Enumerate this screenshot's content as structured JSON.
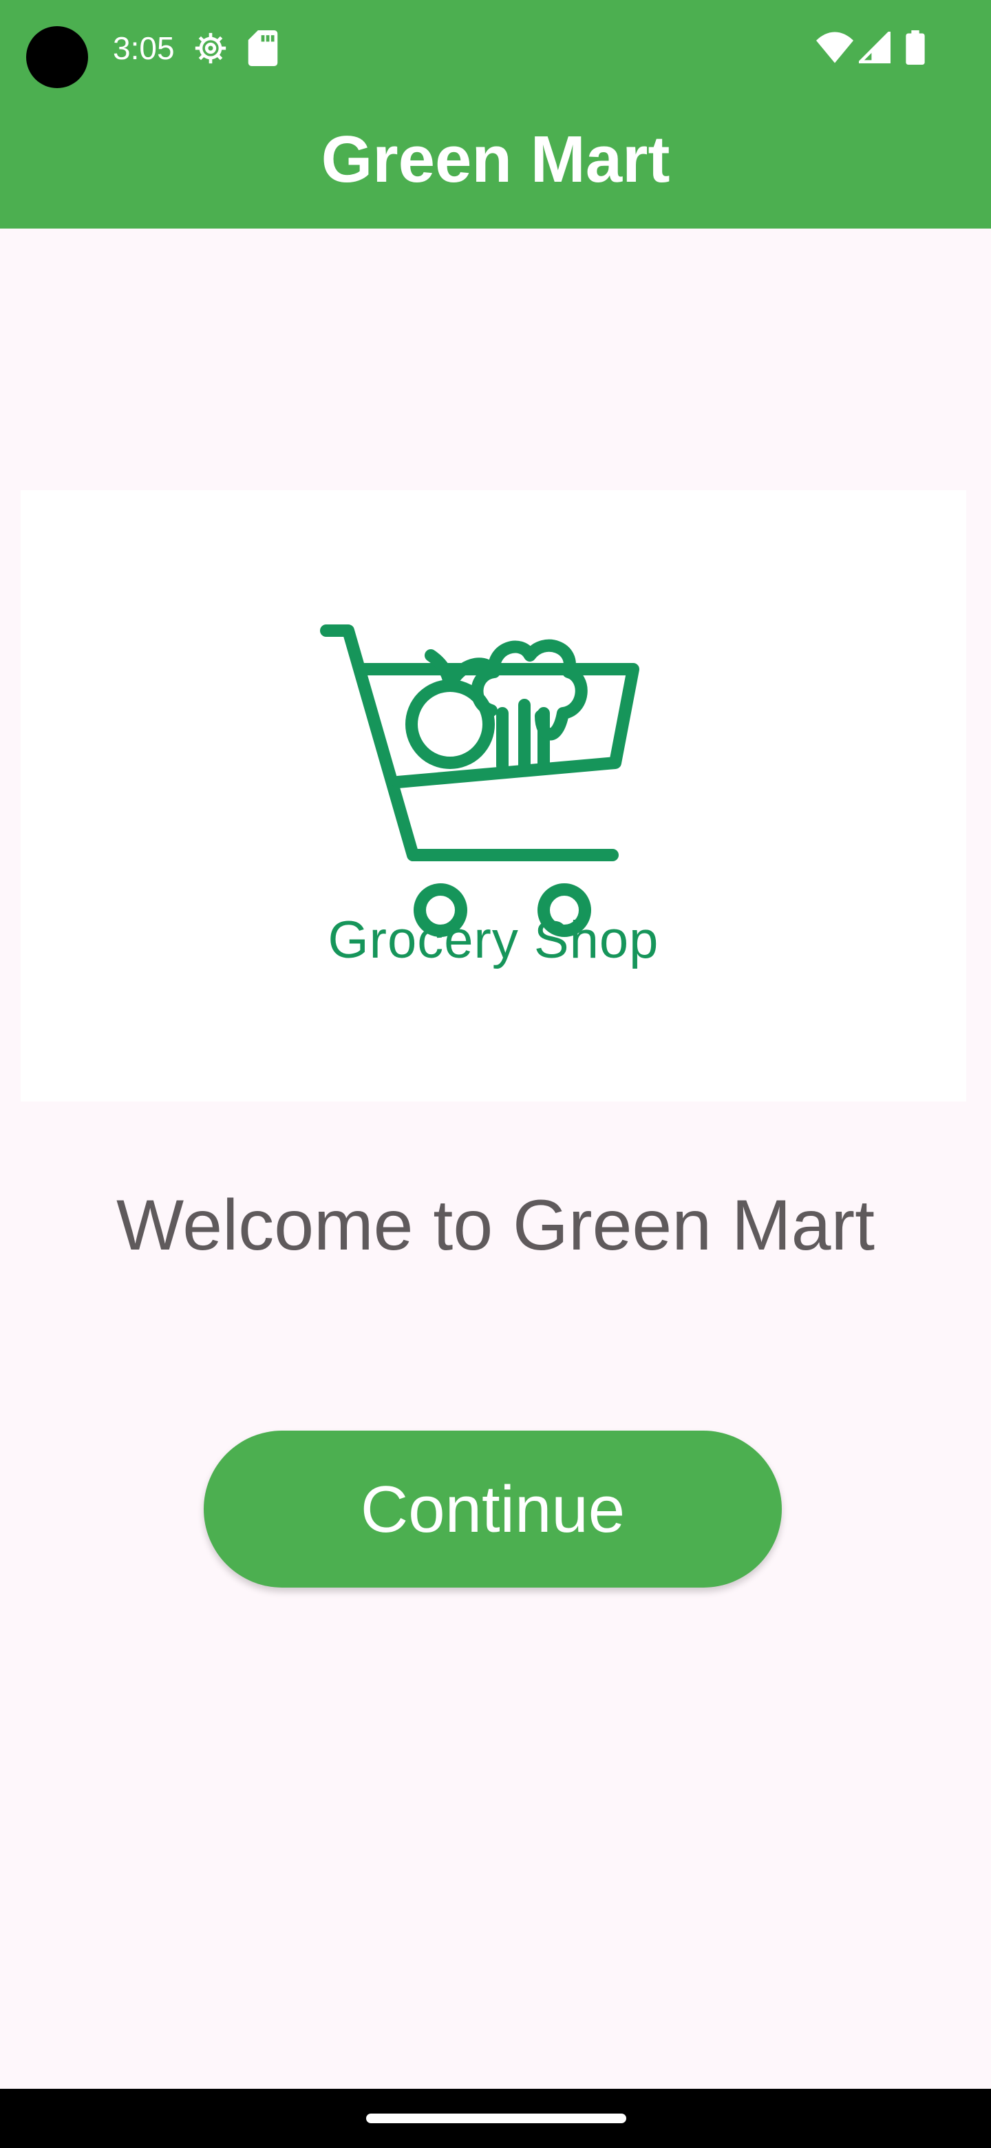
{
  "status_bar": {
    "time": "3:05",
    "icons": [
      "gear-icon",
      "sd-card-icon",
      "wifi-icon",
      "signal-icon",
      "battery-icon"
    ]
  },
  "app_bar": {
    "title": "Green Mart",
    "color": "#4caf50"
  },
  "logo": {
    "caption": "Grocery Shop",
    "icon": "shopping-cart-icon",
    "color": "#16955a"
  },
  "main": {
    "welcome_text": "Welcome to Green Mart",
    "continue_label": "Continue"
  },
  "colors": {
    "accent": "#4caf50",
    "background": "#fef7fb",
    "text": "#5f5a5c"
  }
}
